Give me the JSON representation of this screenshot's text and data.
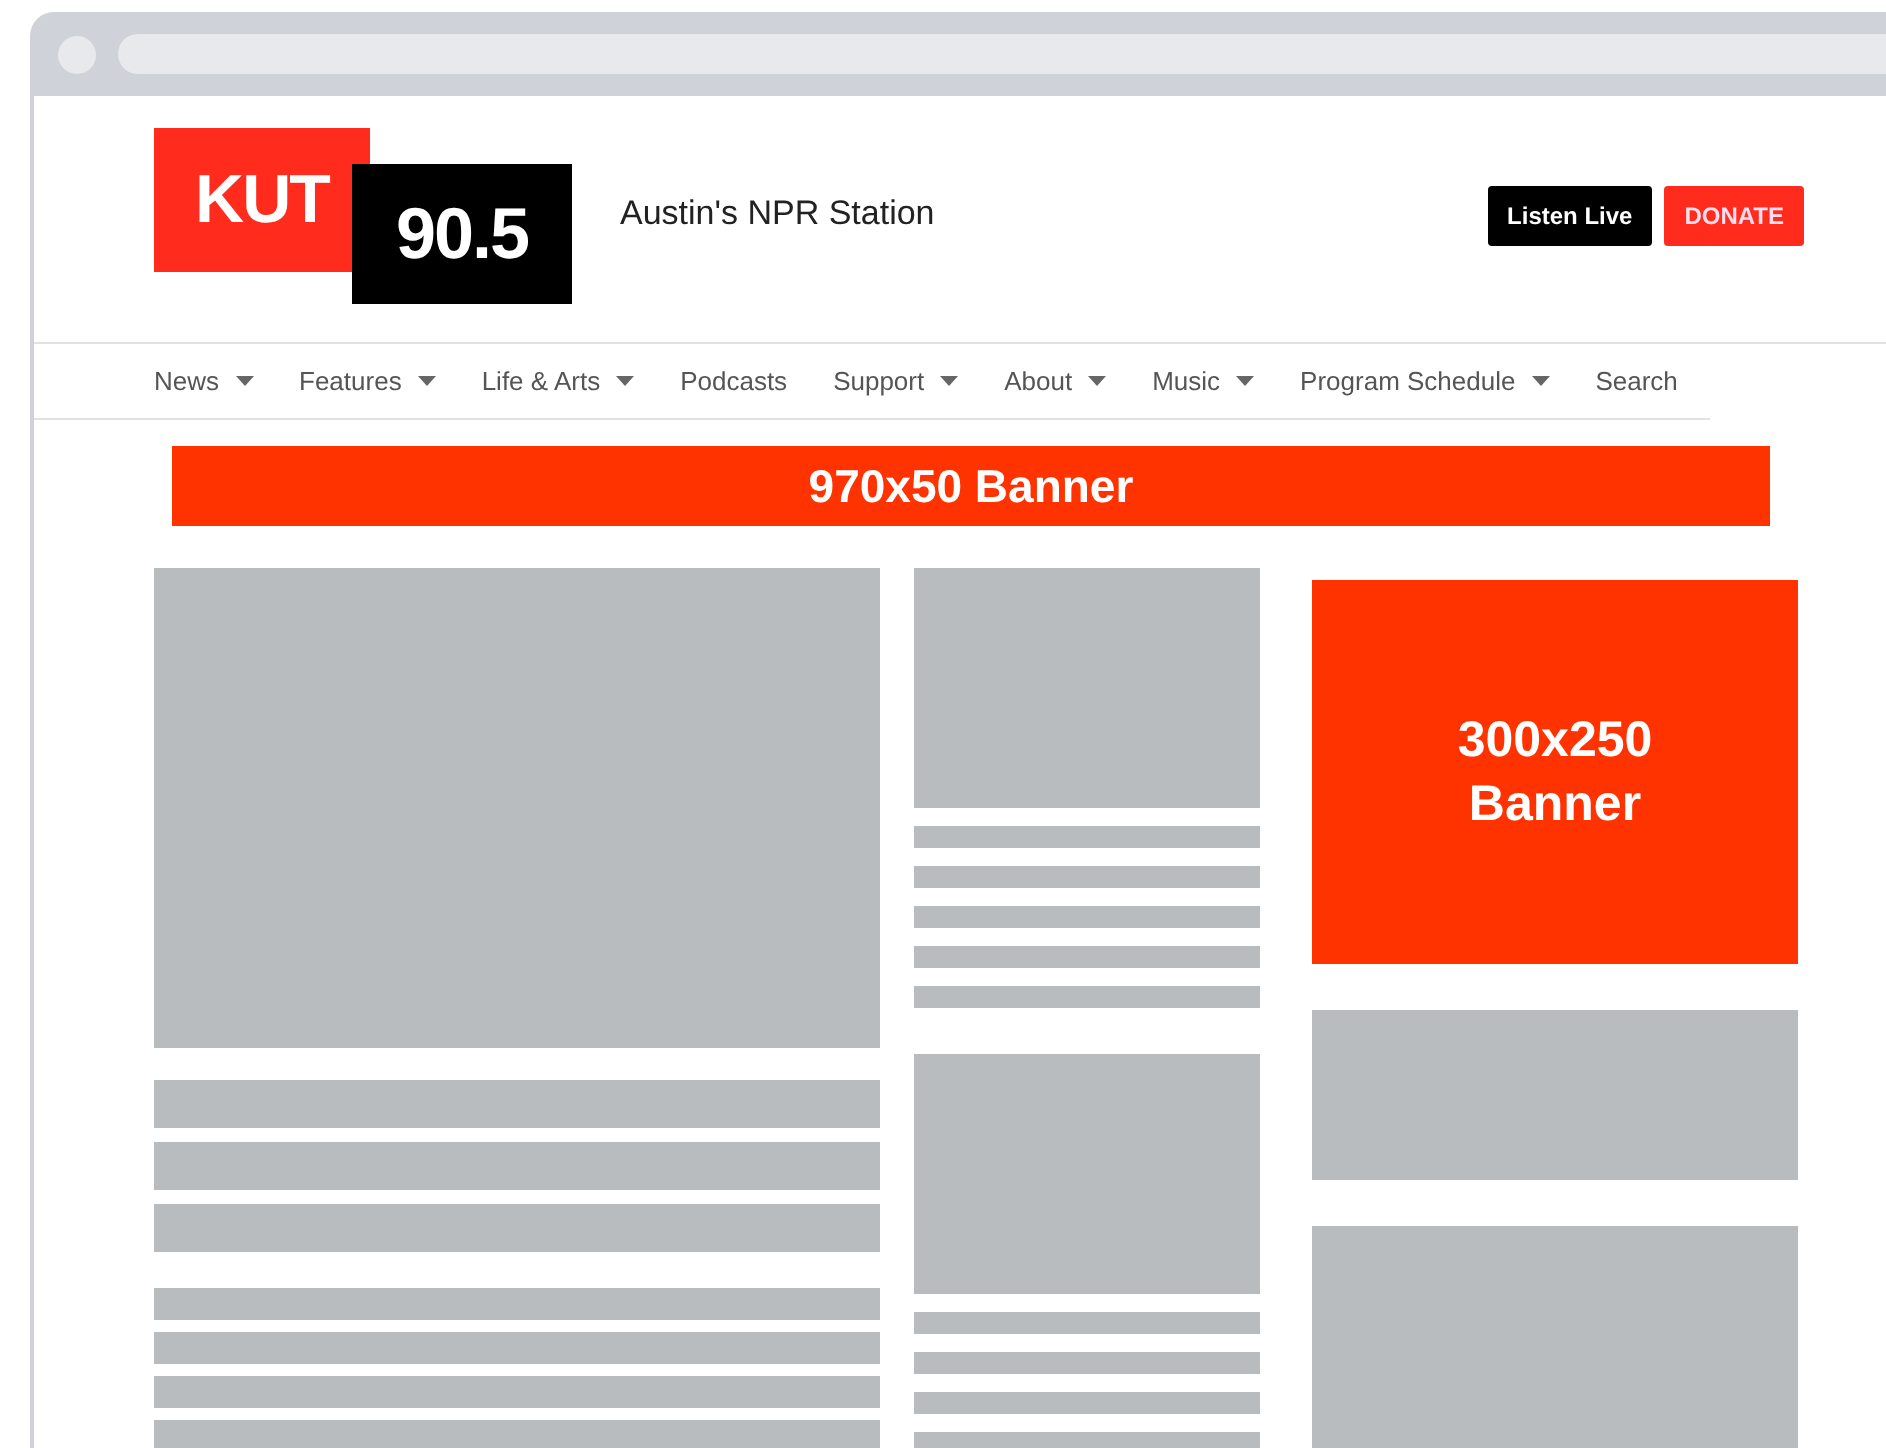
{
  "logo": {
    "word": "KUT",
    "frequency": "90.5"
  },
  "tagline": "Austin's NPR Station",
  "header_buttons": [
    {
      "label": "Listen Live",
      "kind": "dark"
    },
    {
      "label": "DONATE",
      "kind": "accent"
    }
  ],
  "nav": [
    {
      "label": "News",
      "dropdown": true
    },
    {
      "label": "Features",
      "dropdown": true
    },
    {
      "label": "Life & Arts",
      "dropdown": true
    },
    {
      "label": "Podcasts",
      "dropdown": false
    },
    {
      "label": "Support",
      "dropdown": true
    },
    {
      "label": "About",
      "dropdown": true
    },
    {
      "label": "Music",
      "dropdown": true
    },
    {
      "label": "Program Schedule",
      "dropdown": true
    },
    {
      "label": "Search",
      "dropdown": false
    }
  ],
  "leaderboard_banner": "970x50 Banner",
  "columns": [
    {
      "blocks": [
        {
          "kind": "hero"
        },
        {
          "kind": "bar"
        },
        {
          "kind": "bar"
        },
        {
          "kind": "bar"
        },
        {
          "kind": "gap"
        },
        {
          "kind": "line"
        },
        {
          "kind": "line"
        },
        {
          "kind": "line"
        },
        {
          "kind": "line"
        }
      ]
    },
    {
      "blocks": [
        {
          "kind": "thumbnail"
        },
        {
          "kind": "line"
        },
        {
          "kind": "line"
        },
        {
          "kind": "line"
        },
        {
          "kind": "line"
        },
        {
          "kind": "line"
        },
        {
          "kind": "gap"
        },
        {
          "kind": "thumbnail"
        },
        {
          "kind": "line"
        },
        {
          "kind": "line"
        },
        {
          "kind": "line"
        },
        {
          "kind": "line"
        }
      ]
    },
    {
      "blocks": [
        {
          "kind": "ad",
          "lines": [
            "300x250",
            "Banner"
          ]
        },
        {
          "kind": "tile"
        },
        {
          "kind": "panel"
        }
      ]
    }
  ]
}
